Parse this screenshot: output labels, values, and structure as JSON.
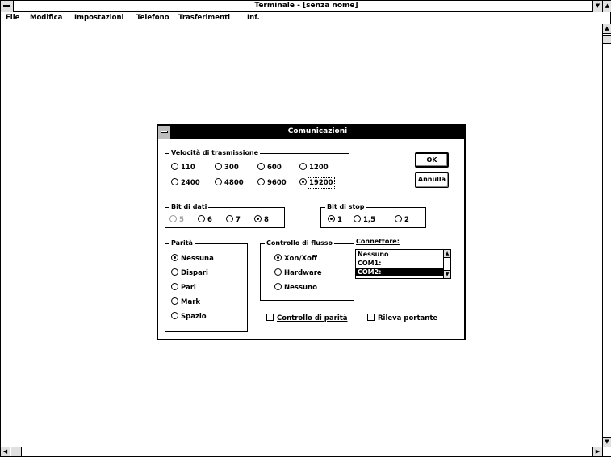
{
  "window": {
    "title": "Terminale - [senza nome]"
  },
  "menubar": {
    "items": [
      {
        "label": "File"
      },
      {
        "label": "Modifica"
      },
      {
        "label": "Impostazioni"
      },
      {
        "label": "Telefono"
      },
      {
        "label": "Trasferimenti"
      },
      {
        "label": "Inf."
      }
    ]
  },
  "dialog": {
    "title": "Comunicazioni",
    "ok_label": "OK",
    "cancel_label": "Annulla",
    "baud": {
      "label": "Velocità di trasmissione",
      "options": [
        "110",
        "300",
        "600",
        "1200",
        "2400",
        "4800",
        "9600",
        "19200"
      ],
      "selected": "19200"
    },
    "data_bits": {
      "label": "Bit di dati",
      "options": [
        "5",
        "6",
        "7",
        "8"
      ],
      "selected": "8",
      "disabled": [
        "5"
      ]
    },
    "stop_bits": {
      "label": "Bit di stop",
      "options": [
        "1",
        "1,5",
        "2"
      ],
      "selected": "1"
    },
    "parity": {
      "label": "Parità",
      "options": [
        "Nessuna",
        "Dispari",
        "Pari",
        "Mark",
        "Spazio"
      ],
      "selected": "Nessuna"
    },
    "flow_control": {
      "label": "Controllo di flusso",
      "options": [
        "Xon/Xoff",
        "Hardware",
        "Nessuno"
      ],
      "selected": "Xon/Xoff"
    },
    "connection": {
      "label": "Connettore:",
      "items": [
        "Nessuno",
        "COM1:",
        "COM2:"
      ],
      "selected": "COM2:"
    },
    "parity_check_label": "Controllo di parità",
    "carrier_detect_label": "Rileva portante"
  },
  "colors": {
    "title_active_bg": "#000000",
    "title_active_fg": "#ffffff",
    "window_bg": "#ffffff"
  }
}
